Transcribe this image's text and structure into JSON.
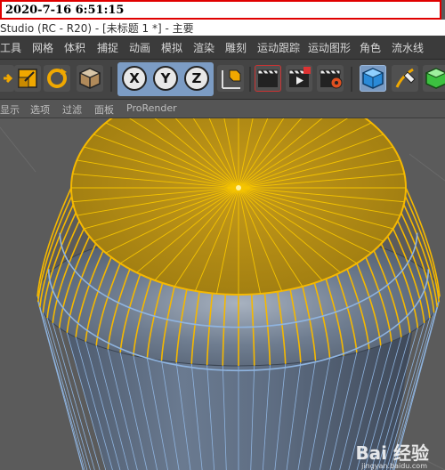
{
  "timestamp": "2020-7-16 6:51:15",
  "window_title": "Studio (RC - R20) - [未标题 1 *] - 主要",
  "menu": [
    "工具",
    "网格",
    "体积",
    "捕捉",
    "动画",
    "模拟",
    "渲染",
    "雕刻",
    "运动跟踪",
    "运动图形",
    "角色",
    "流水线"
  ],
  "toolbar": {
    "axis_x": "X",
    "axis_y": "Y",
    "axis_z": "Z"
  },
  "submenu": [
    "显示",
    "选项",
    "过滤",
    "面板",
    "ProRender"
  ],
  "watermark": {
    "brand": "Bai 经验",
    "url": "jingyan.baidu.com"
  },
  "colors": {
    "selection": "#f5b800",
    "wire": "#8fb4e0",
    "mesh": "#5f6f84"
  }
}
